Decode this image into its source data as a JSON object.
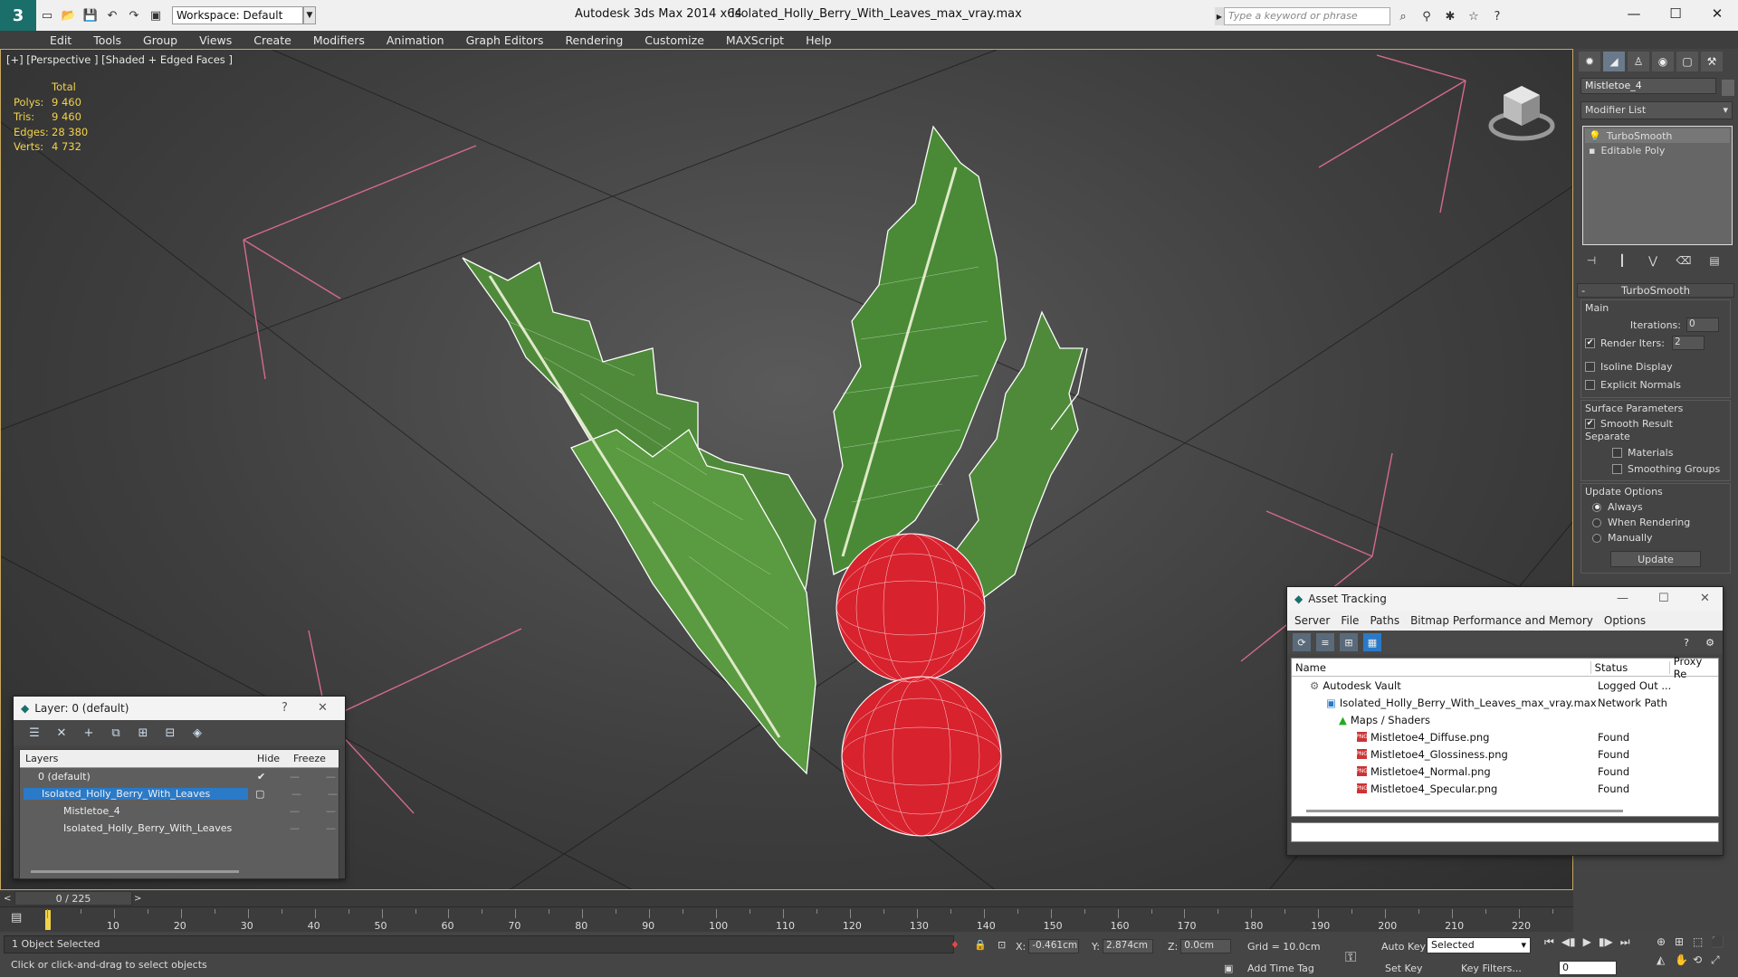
{
  "app": {
    "title": "Autodesk 3ds Max  2014 x64",
    "file": "Isolated_Holly_Berry_With_Leaves_max_vray.max",
    "workspace": "Workspace: Default",
    "search_placeholder": "Type a keyword or phrase"
  },
  "menu": [
    "Edit",
    "Tools",
    "Group",
    "Views",
    "Create",
    "Modifiers",
    "Animation",
    "Graph Editors",
    "Rendering",
    "Customize",
    "MAXScript",
    "Help"
  ],
  "viewport": {
    "label": "[+] [Perspective ] [Shaded + Edged Faces ]",
    "stats": {
      "header": "Total",
      "rows": [
        {
          "label": "Polys:",
          "value": "9 460"
        },
        {
          "label": "Tris:",
          "value": "9 460"
        },
        {
          "label": "Edges:",
          "value": "28 380"
        },
        {
          "label": "Verts:",
          "value": "4 732"
        }
      ]
    }
  },
  "command_panel": {
    "object_name": "Mistletoe_4",
    "modifier_list": "Modifier List",
    "stack": [
      "TurboSmooth",
      "Editable Poly"
    ],
    "rollout": "TurboSmooth",
    "main_label": "Main",
    "iterations_label": "Iterations:",
    "iterations": "0",
    "render_iters_label": "Render Iters:",
    "render_iters": "2",
    "isoline": "Isoline Display",
    "explicit_normals": "Explicit Normals",
    "surface_params": "Surface Parameters",
    "smooth_result": "Smooth Result",
    "separate": "Separate",
    "materials": "Materials",
    "smoothing_groups": "Smoothing Groups",
    "update_options": "Update Options",
    "always": "Always",
    "when_rendering": "When Rendering",
    "manually": "Manually",
    "update_button": "Update"
  },
  "layer_panel": {
    "title": "Layer: 0 (default)",
    "help": "?",
    "columns": [
      "Layers",
      "Hide",
      "Freeze"
    ],
    "rows": [
      {
        "name": "0 (default)",
        "indent": 1
      },
      {
        "name": "Isolated_Holly_Berry_With_Leaves",
        "indent": 1,
        "selected": true
      },
      {
        "name": "Mistletoe_4",
        "indent": 2
      },
      {
        "name": "Isolated_Holly_Berry_With_Leaves",
        "indent": 2
      }
    ]
  },
  "asset_panel": {
    "title": "Asset Tracking",
    "menu": [
      "Server",
      "File",
      "Paths",
      "Bitmap Performance and Memory",
      "Options"
    ],
    "columns": [
      "Name",
      "Status",
      "Proxy Re"
    ],
    "rows": [
      {
        "name": "Autodesk Vault",
        "status": "Logged Out ...",
        "indent": 1
      },
      {
        "name": "Isolated_Holly_Berry_With_Leaves_max_vray.max",
        "status": "Network Path",
        "indent": 2
      },
      {
        "name": "Maps / Shaders",
        "status": "",
        "indent": 3
      },
      {
        "name": "Mistletoe4_Diffuse.png",
        "status": "Found",
        "indent": 4
      },
      {
        "name": "Mistletoe4_Glossiness.png",
        "status": "Found",
        "indent": 4
      },
      {
        "name": "Mistletoe4_Normal.png",
        "status": "Found",
        "indent": 4
      },
      {
        "name": "Mistletoe4_Specular.png",
        "status": "Found",
        "indent": 4
      }
    ]
  },
  "timeline": {
    "slider_text": "0 / 225",
    "ticks": [
      "10",
      "20",
      "30",
      "40",
      "50",
      "60",
      "70",
      "80",
      "90",
      "100",
      "110",
      "120",
      "130",
      "140",
      "150",
      "160",
      "170",
      "180",
      "190",
      "200",
      "210",
      "220"
    ]
  },
  "status": {
    "selection": "1 Object Selected",
    "prompt": "Click or click-and-drag to select objects",
    "x_label": "X:",
    "x": "-0.461cm",
    "y_label": "Y:",
    "y": "2.874cm",
    "z_label": "Z:",
    "z": "0.0cm",
    "grid": "Grid = 10.0cm",
    "add_time_tag": "Add Time Tag",
    "auto_key": "Auto Key",
    "set_key": "Set Key",
    "selected": "Selected",
    "key_filters": "Key Filters...",
    "frame": "0"
  },
  "colors": {
    "leaf": "#4f8a3a",
    "berry": "#d8222e",
    "accent": "#2a7ac8",
    "stats": "#f2d24a"
  }
}
